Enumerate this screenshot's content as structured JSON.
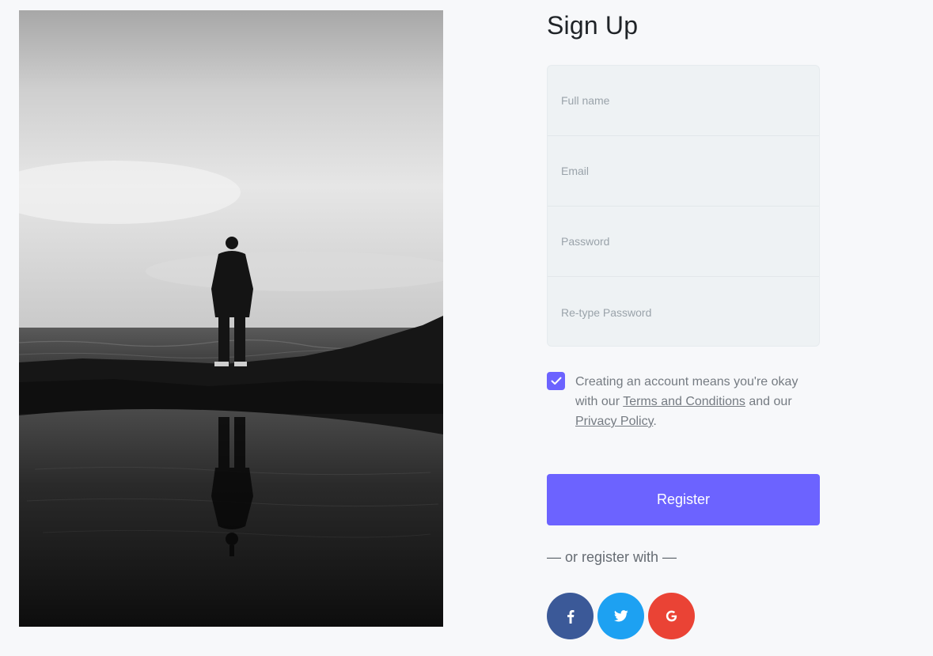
{
  "hero_image": {
    "alt": "Silhouette of a person standing on rocks by the sea, reflected in a tide pool"
  },
  "signup": {
    "title": "Sign Up",
    "fields": {
      "full_name_placeholder": "Full name",
      "email_placeholder": "Email",
      "password_placeholder": "Password",
      "retype_password_placeholder": "Re-type Password"
    },
    "consent": {
      "checked": true,
      "text_before": "Creating an account means you're okay with our ",
      "terms_link": "Terms and Conditions",
      "text_middle": " and our ",
      "privacy_link": "Privacy Policy",
      "text_after": "."
    },
    "register_label": "Register",
    "alt_register_text": "— or register with —",
    "socials": [
      {
        "name": "facebook",
        "icon": "facebook-icon",
        "color": "#3b5998"
      },
      {
        "name": "twitter",
        "icon": "twitter-icon",
        "color": "#1da1f2"
      },
      {
        "name": "google",
        "icon": "google-icon",
        "color": "#ea4335"
      }
    ]
  },
  "theme": {
    "accent": "#6c63ff",
    "background": "#f7f8fa",
    "field_background": "#eef2f4"
  }
}
